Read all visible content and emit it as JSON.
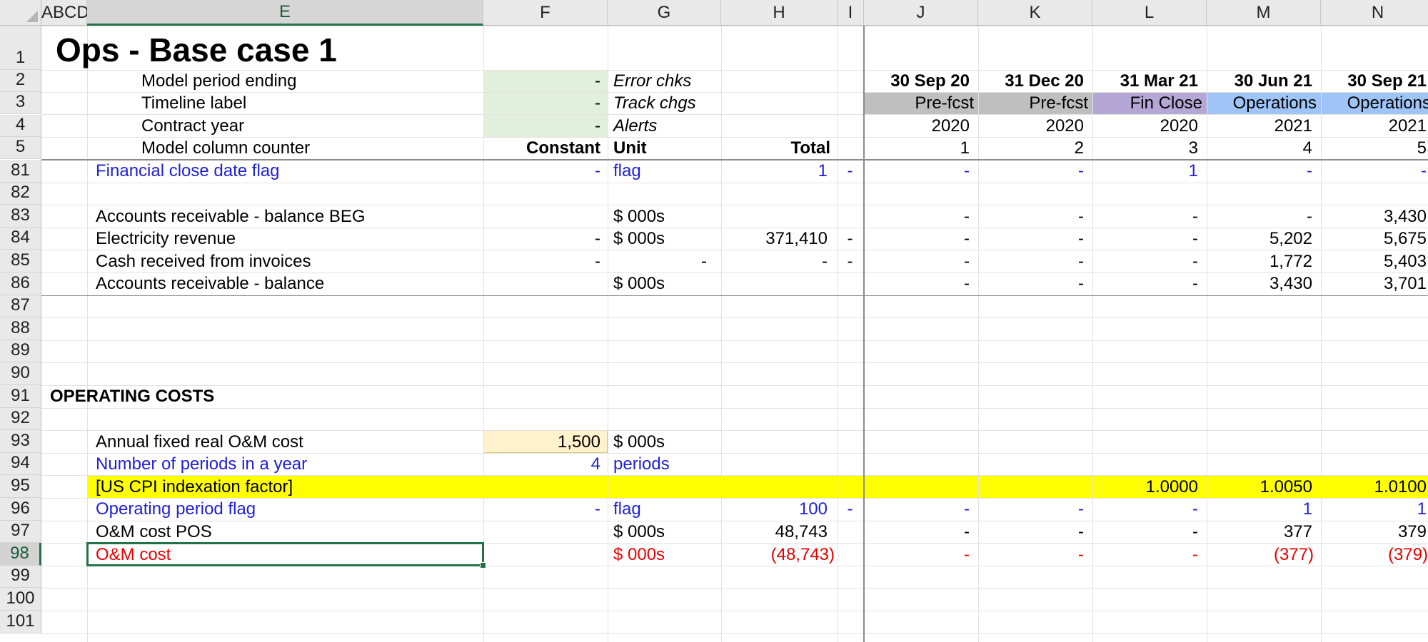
{
  "colors": {
    "header_bg": "#e9e9e9",
    "selected_accent": "#217346",
    "input_green": "#e2efda",
    "input_yellow": "#fff2cc",
    "pre_fcst": "#bfbfbf",
    "fin_close": "#b4a7d6",
    "operations": "#9fc5f8",
    "highlight_yellow": "#ffff00",
    "link_blue": "#1f1fd6",
    "negative_red": "#e60000"
  },
  "columns": [
    "ABCD",
    "E",
    "F",
    "G",
    "H",
    "I",
    "J",
    "K",
    "L",
    "M",
    "N"
  ],
  "rows": {
    "header_top": [
      "1",
      "2",
      "3",
      "4",
      "5"
    ],
    "body": [
      "81",
      "82",
      "83",
      "84",
      "85",
      "86",
      "87",
      "88",
      "89",
      "90",
      "91",
      "92",
      "93",
      "94",
      "95",
      "96",
      "97",
      "98",
      "99",
      "100",
      "101"
    ],
    "selected": "98"
  },
  "title": "Ops - Base case 1",
  "header": {
    "labels": [
      "Model period ending",
      "Timeline label",
      "Contract year",
      "Model column counter"
    ],
    "dash": "-",
    "checks": [
      "Error chks",
      "Track chgs",
      "Alerts"
    ],
    "constant": "Constant",
    "unit": "Unit",
    "total": "Total",
    "dates": [
      "30 Sep 20",
      "31 Dec 20",
      "31 Mar 21",
      "30 Jun 21",
      "30 Sep 21"
    ],
    "timeline": [
      "Pre-fcst",
      "Pre-fcst",
      "Fin Close",
      "Operations",
      "Operations"
    ],
    "years": [
      "2020",
      "2020",
      "2020",
      "2021",
      "2021"
    ],
    "counters": [
      "1",
      "2",
      "3",
      "4",
      "5"
    ]
  },
  "section_title": "OPERATING COSTS",
  "lines": {
    "fin_close_flag": {
      "label": "Financial close date flag",
      "f": "-",
      "unit": "flag",
      "total": "1",
      "i": "-",
      "vals": [
        "-",
        "-",
        "1",
        "-",
        "-"
      ]
    },
    "ar_beg": {
      "label": "Accounts receivable - balance BEG",
      "unit": "$ 000s",
      "vals": [
        "-",
        "-",
        "-",
        "-",
        "3,430"
      ]
    },
    "elec_rev": {
      "label": "Electricity revenue",
      "f": "-",
      "unit": "$ 000s",
      "total": "371,410",
      "i": "-",
      "vals": [
        "-",
        "-",
        "-",
        "5,202",
        "5,675"
      ]
    },
    "cash_recv": {
      "label": "Cash received from invoices",
      "f": "-",
      "g": "-",
      "total": "-",
      "i": "-",
      "vals": [
        "-",
        "-",
        "-",
        "1,772",
        "5,403"
      ]
    },
    "ar_bal": {
      "label": "Accounts receivable - balance",
      "unit": "$ 000s",
      "vals": [
        "-",
        "-",
        "-",
        "3,430",
        "3,701"
      ]
    },
    "om_fixed": {
      "label": "Annual fixed real O&M cost",
      "f": "1,500",
      "unit": "$ 000s"
    },
    "periods": {
      "label": "Number of periods in a year",
      "f": "4",
      "unit": "periods"
    },
    "cpi": {
      "label": "[US CPI indexation factor]",
      "vals": [
        "",
        "",
        "1.0000",
        "1.0050",
        "1.0100"
      ]
    },
    "op_flag": {
      "label": "Operating period flag",
      "f": "-",
      "unit": "flag",
      "total": "100",
      "i": "-",
      "vals": [
        "-",
        "-",
        "-",
        "1",
        "1"
      ]
    },
    "om_pos": {
      "label": "O&M cost POS",
      "unit": "$ 000s",
      "total": "48,743",
      "vals": [
        "-",
        "-",
        "-",
        "377",
        "379"
      ]
    },
    "om_cost": {
      "label": "O&M cost",
      "unit": "$ 000s",
      "total": "(48,743)",
      "vals": [
        "-",
        "-",
        "-",
        "(377)",
        "(379)"
      ]
    }
  }
}
